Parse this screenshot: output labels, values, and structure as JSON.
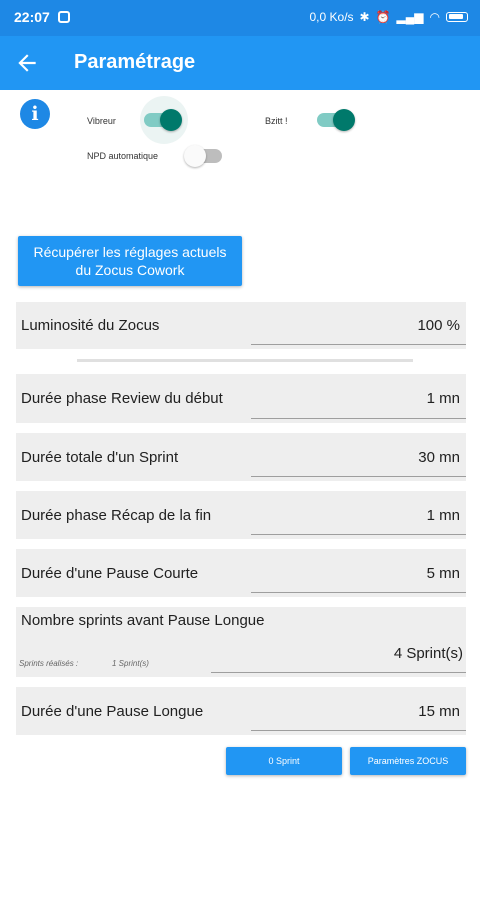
{
  "status_bar": {
    "time": "22:07",
    "net_speed": "0,0 Ko/s"
  },
  "app_bar": {
    "title": "Paramétrage"
  },
  "toggles": {
    "vibreur": {
      "label": "Vibreur",
      "on": true
    },
    "bzitt": {
      "label": "Bzitt !",
      "on": true
    },
    "npd": {
      "label": "NPD automatique",
      "on": false
    }
  },
  "fetch_button": {
    "label": "Récupérer les réglages actuels du Zocus Cowork"
  },
  "settings": {
    "luminosite": {
      "label": "Luminosité du Zocus",
      "value": "100 %"
    },
    "review": {
      "label": "Durée phase Review du début",
      "value": "1 mn"
    },
    "sprint": {
      "label": "Durée totale d'un Sprint",
      "value": "30 mn"
    },
    "recap": {
      "label": "Durée phase Récap de la fin",
      "value": "1 mn"
    },
    "pause_courte": {
      "label": "Durée d'une Pause Courte",
      "value": "5 mn"
    },
    "nb_sprints": {
      "label": "Nombre sprints avant Pause Longue",
      "value": "4 Sprint(s)",
      "sub_label": "Sprints réalisés :",
      "sub_value": "1 Sprint(s)"
    },
    "pause_longue": {
      "label": "Durée d'une Pause Longue",
      "value": "15 mn"
    }
  },
  "buttons": {
    "sprint": "0 Sprint",
    "params": "Paramètres ZOCUS"
  }
}
